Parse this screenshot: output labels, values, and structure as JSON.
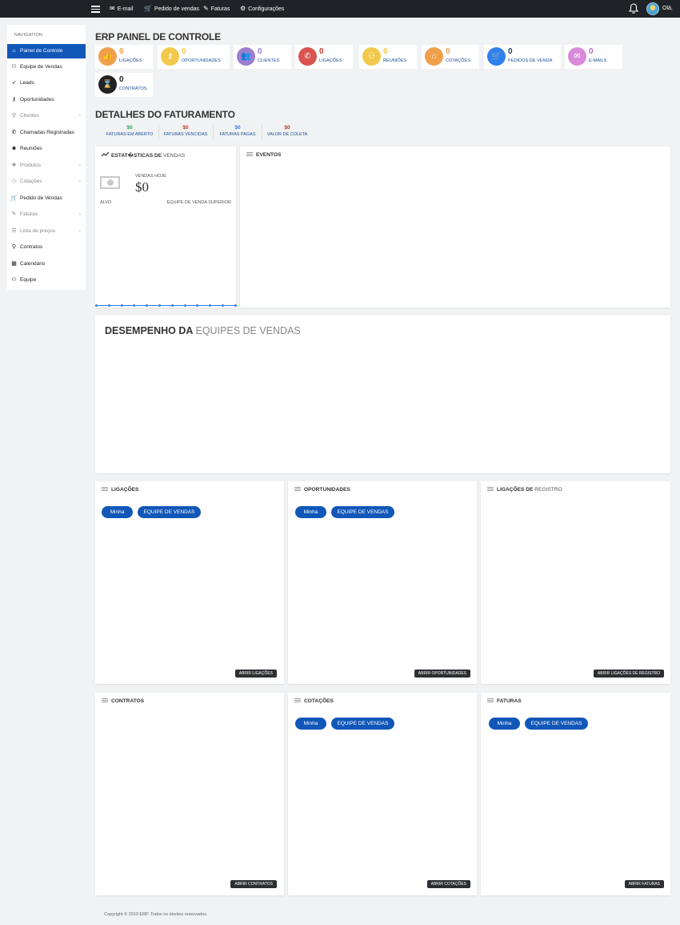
{
  "topbar": {
    "links": [
      {
        "label": "E-mail",
        "icon": "envelope-icon"
      },
      {
        "label": "Pedido de vendas",
        "icon": "cart-icon"
      },
      {
        "label": "Faturas",
        "icon": "edit-icon"
      },
      {
        "label": "Configurações",
        "icon": "gear-icon"
      }
    ],
    "greeting": "Olá,"
  },
  "sidebar": {
    "heading": "NAVIGATION",
    "items": [
      {
        "label": "Painel de Controle",
        "icon": "home-icon",
        "active": true
      },
      {
        "label": "Equipe de Vendas",
        "icon": "users-icon"
      },
      {
        "label": "Leads",
        "icon": "rocket-icon"
      },
      {
        "label": "Oportunidades",
        "icon": "key-icon"
      },
      {
        "label": "Clientes",
        "icon": "user-icon",
        "submenu": true
      },
      {
        "label": "Chamadas Registradas",
        "icon": "phone-icon"
      },
      {
        "label": "Reuniões",
        "icon": "person-icon"
      },
      {
        "label": "Produtos",
        "icon": "cubes-icon",
        "submenu": true
      },
      {
        "label": "Cotações",
        "icon": "tag-icon",
        "submenu": true
      },
      {
        "label": "Pedido de Vendas",
        "icon": "cart-icon"
      },
      {
        "label": "Faturas",
        "icon": "edit-icon",
        "submenu": true
      },
      {
        "label": "Lista de preços",
        "icon": "list-icon",
        "submenu": true
      },
      {
        "label": "Contratos",
        "icon": "search-icon"
      },
      {
        "label": "Calendário",
        "icon": "calendar-icon"
      },
      {
        "label": "Equipe",
        "icon": "team-icon"
      }
    ]
  },
  "dashboard": {
    "title": "ERP PAINEL DE CONTROLE",
    "stats": [
      {
        "value": "0",
        "label": "LIGAÇÕES",
        "color": "#f0a04b",
        "num_color": "#f0a04b",
        "icon": "thumbs-up-icon",
        "glyph": "👍"
      },
      {
        "value": "0",
        "label": "OPORTUNIDADES",
        "color": "#f2c94c",
        "num_color": "#f2c94c",
        "icon": "key-icon",
        "glyph": "⚷"
      },
      {
        "value": "0",
        "label": "CLIENTES",
        "color": "#9b7fd1",
        "num_color": "#9b7fd1",
        "icon": "users-icon",
        "glyph": "👥"
      },
      {
        "value": "0",
        "label": "LIGAÇÕES",
        "color": "#d9534f",
        "num_color": "#c0392b",
        "icon": "phone-icon",
        "glyph": "✆"
      },
      {
        "value": "0",
        "label": "REUNIÕES",
        "color": "#f2c94c",
        "num_color": "#f2c94c",
        "icon": "user-icon",
        "glyph": "⚇"
      },
      {
        "value": "0",
        "label": "COTAÇÕES",
        "color": "#f0a04b",
        "num_color": "#f0a04b",
        "icon": "tag-icon",
        "glyph": "⌂"
      },
      {
        "value": "0",
        "label": "PEDIDOS DE VENDA",
        "color": "#2f80ed",
        "num_color": "#1a3a6b",
        "icon": "cart-icon",
        "glyph": "🛒"
      },
      {
        "value": "0",
        "label": "E-MAILS",
        "color": "#d98ad9",
        "num_color": "#b36bb3",
        "icon": "envelope-icon",
        "glyph": "✉"
      },
      {
        "value": "0",
        "label": "CONTRATOS",
        "color": "#222222",
        "num_color": "#222222",
        "icon": "hourglass-icon",
        "glyph": "⌛"
      }
    ]
  },
  "billing": {
    "title": "DETALHES DO FATURAMENTO",
    "items": [
      {
        "value": "$0",
        "label": "FATURAS EM ABERTO",
        "color": "#27ae60"
      },
      {
        "value": "$0",
        "label": "FATURAS VENCIDAS",
        "color": "#c0392b"
      },
      {
        "value": "$0",
        "label": "FATURAS PAGAS",
        "color": "#2f80ed"
      },
      {
        "value": "$0",
        "label": "VALOR DE COLETA",
        "color": "#c0392b"
      }
    ]
  },
  "sales_stats": {
    "title_bold": "ESTAT�STICAS DE",
    "title_light": "VENDAS",
    "today_label": "VENDAS HOJE",
    "today_value": "$0",
    "target_label": "ALVO",
    "top_team_label": "EQUIPE DE VENDA SUPERIOR"
  },
  "events": {
    "title": "EVENTOS"
  },
  "performance": {
    "title_bold": "DESEMPENHO DA",
    "title_light": "EQUIPES DE VENDAS"
  },
  "panels": {
    "calls": {
      "title": "LIGAÇÕES",
      "tab_mine": "Minha",
      "tab_team": "EQUIPE DE VENDAS",
      "open": "ABRIR LIGAÇÕES"
    },
    "opportunities": {
      "title": "OPORTUNIDADES",
      "tab_mine": "Minha",
      "tab_team": "EQUIPE DE VENDAS",
      "open": "ABRIR OPORTUNIDADES"
    },
    "log_calls": {
      "title_bold": "LIGAÇÕES DE",
      "title_light": "REGISTRO",
      "open": "ABRIR LIGAÇÕES DE REGISTRO"
    },
    "contracts": {
      "title": "CONTRATOS",
      "open": "ABRIR CONTRATOS"
    },
    "quotes": {
      "title": "COTAÇÕES",
      "tab_mine": "Minha",
      "tab_team": "EQUIPE DE VENDAS",
      "open": "ABRIR COTAÇÕES"
    },
    "invoices": {
      "title": "FATURAS",
      "tab_mine": "Minha",
      "tab_team": "EQUIPE DE VENDAS",
      "open": "ABRIR FATURAS"
    }
  },
  "footer": {
    "text": "Copyright © 2019 ERP. Todos os direitos reservados."
  }
}
